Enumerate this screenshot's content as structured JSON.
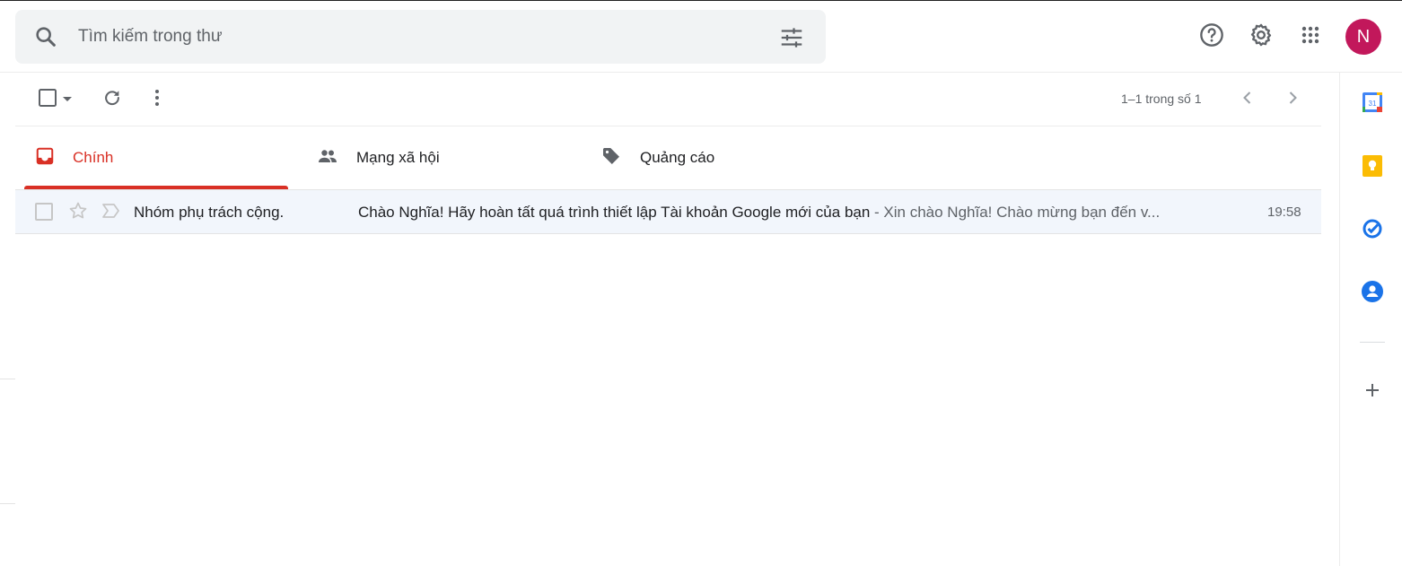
{
  "search": {
    "placeholder": "Tìm kiếm trong thư",
    "icon": "search-icon",
    "options_icon": "tune-icon"
  },
  "header": {
    "help_icon": "help-icon",
    "settings_icon": "gear-icon",
    "apps_icon": "apps-grid-icon",
    "avatar_initial": "N",
    "avatar_color": "#c2185b"
  },
  "toolbar": {
    "pagination": "1–1 trong số 1"
  },
  "tabs": [
    {
      "label": "Chính",
      "icon": "inbox-icon",
      "active": true
    },
    {
      "label": "Mạng xã hội",
      "icon": "people-icon",
      "active": false
    },
    {
      "label": "Quảng cáo",
      "icon": "tag-icon",
      "active": false
    }
  ],
  "emails": [
    {
      "sender": "Nhóm phụ trách cộng.",
      "subject": "Chào Nghĩa! Hãy hoàn tất quá trình thiết lập Tài khoản Google mới của bạn",
      "snippet": " - Xin chào Nghĩa! Chào mừng bạn đến v...",
      "time": "19:58"
    }
  ],
  "colors": {
    "accent": "#d93025",
    "row_bg": "#f2f6fc",
    "search_bg": "#f1f3f4"
  }
}
